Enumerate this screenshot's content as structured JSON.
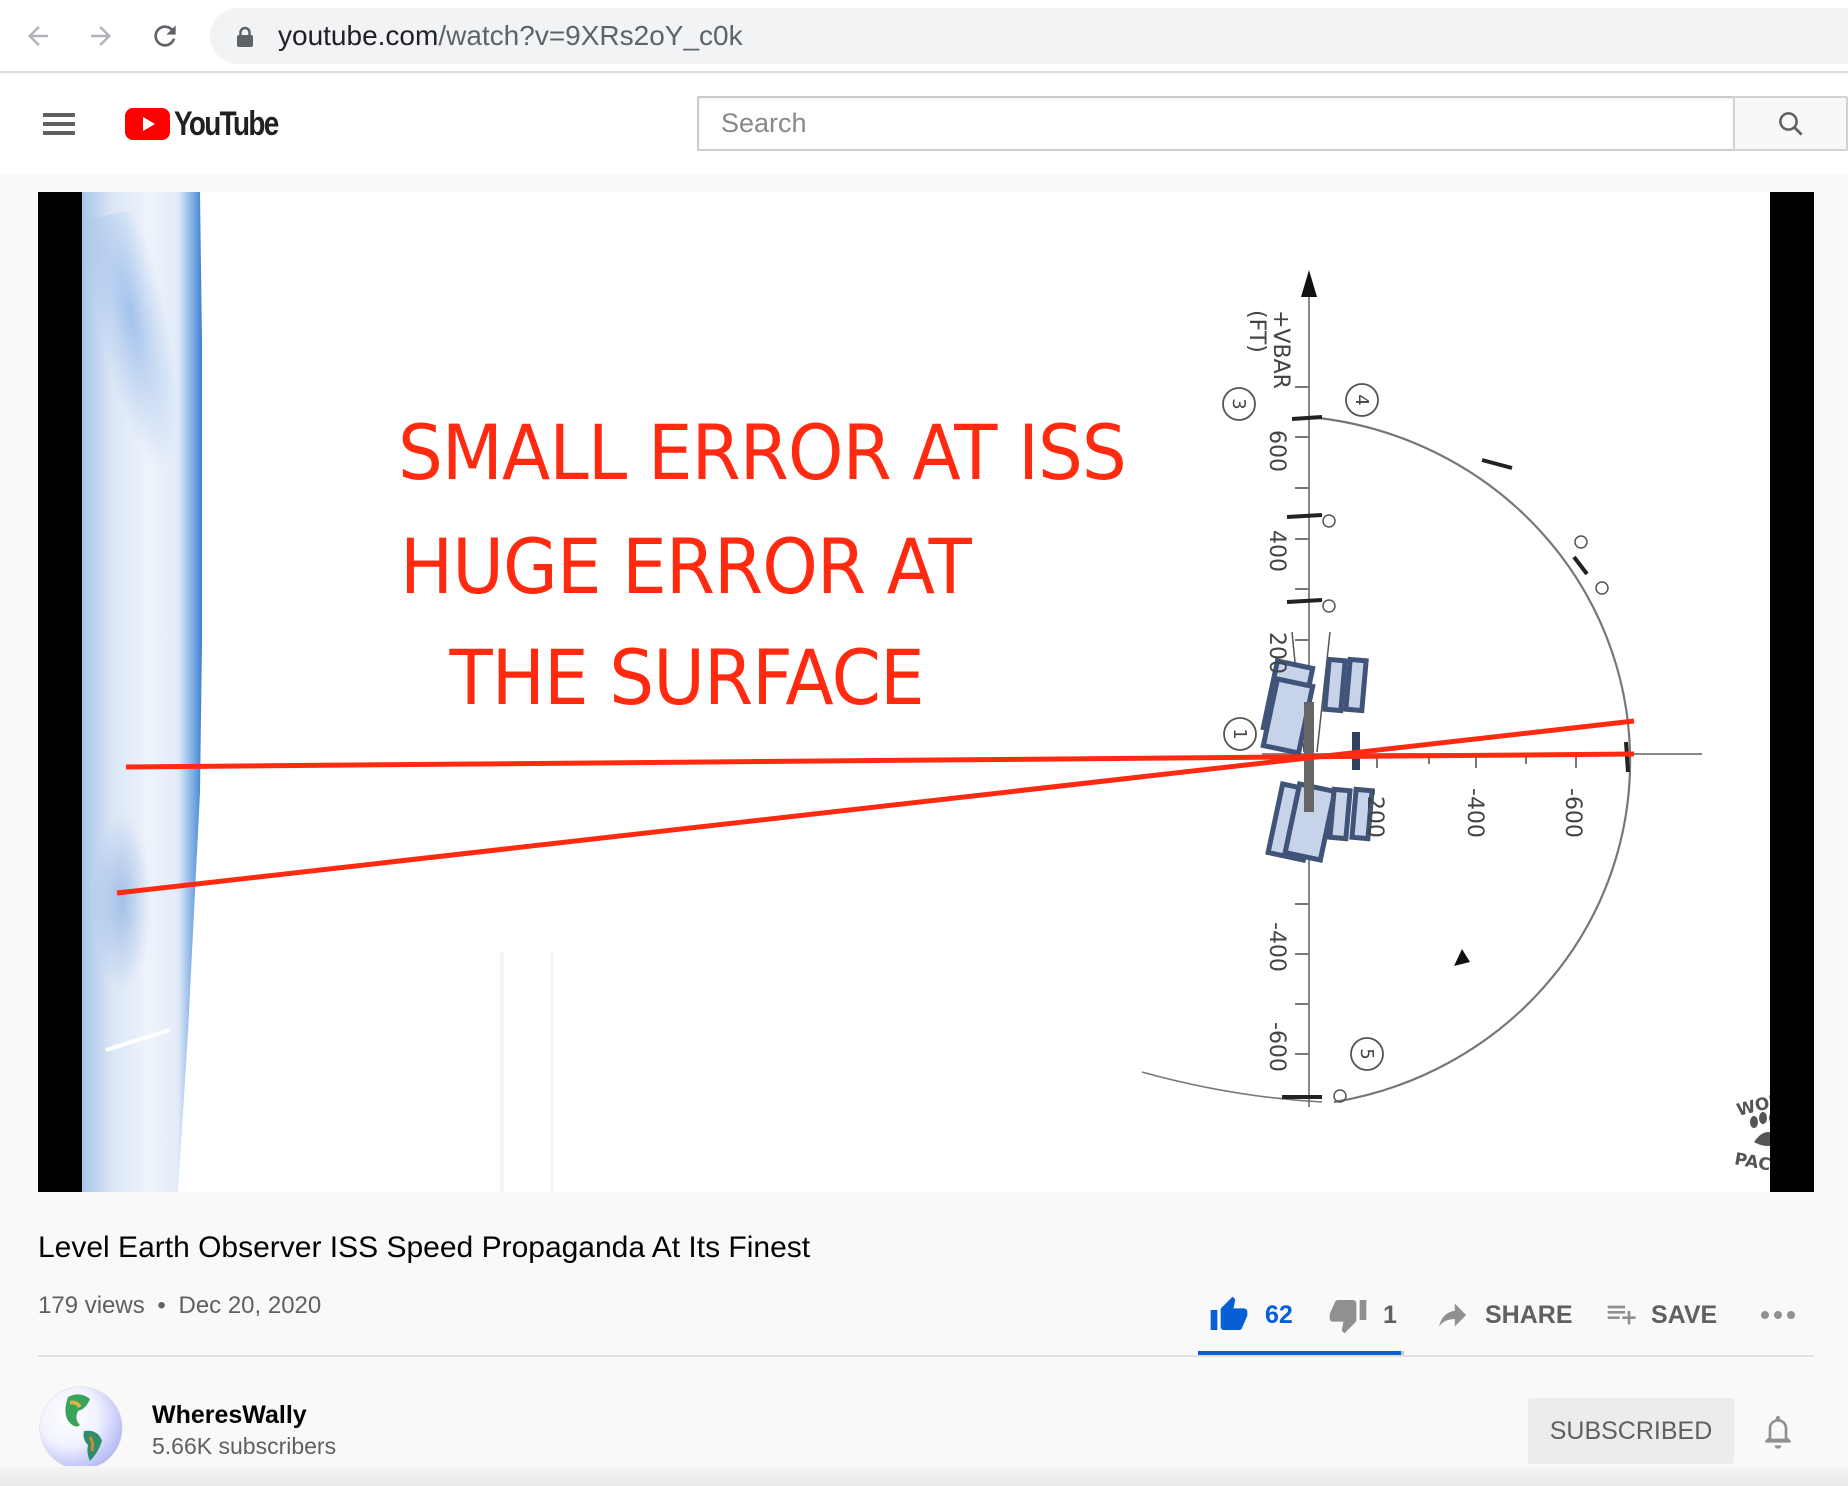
{
  "browser": {
    "url_host": "youtube.com",
    "url_path": "/watch?v=9XRs2oY_c0k",
    "icons": {
      "back": "arrow-left-icon",
      "forward": "arrow-right-icon",
      "reload": "reload-icon",
      "lock": "lock-icon"
    }
  },
  "header": {
    "logo_text": "YouTube",
    "search_placeholder": "Search",
    "search_value": "",
    "icons": {
      "menu": "hamburger-menu-icon",
      "search": "search-icon",
      "logo": "youtube-play-icon"
    },
    "brand_color": "#ff0000"
  },
  "video": {
    "slide_lines": [
      "SMALL ERROR AT ISS",
      "HUGE ERROR AT",
      " THE SURFACE"
    ],
    "diagram": {
      "axis_label_line1": "+VBAR",
      "axis_label_line2": "(FT)",
      "vbar_ticks": [
        "600",
        "400",
        "200",
        "-400",
        "-600"
      ],
      "rbar_ticks": [
        "-200",
        "-400",
        "-600"
      ],
      "waypoints": [
        "1",
        "3",
        "4",
        "5"
      ]
    },
    "watermark_top": "WOLF",
    "watermark_bottom": "PACK",
    "overlay_color": "#ff2a10"
  },
  "info": {
    "title": "Level Earth Observer ISS Speed Propaganda At Its Finest",
    "views": "179 views",
    "separator": "•",
    "date": "Dec 20, 2020",
    "likes": "62",
    "dislikes": "1",
    "like_ratio": 0.984,
    "share_label": "SHARE",
    "save_label": "SAVE",
    "more_icon": "more-horizontal-icon",
    "accent_color": "#065fd4"
  },
  "channel": {
    "name": "WheresWally",
    "subscribers": "5.66K subscribers",
    "subscribe_label": "SUBSCRIBED",
    "bell_icon": "bell-icon"
  }
}
